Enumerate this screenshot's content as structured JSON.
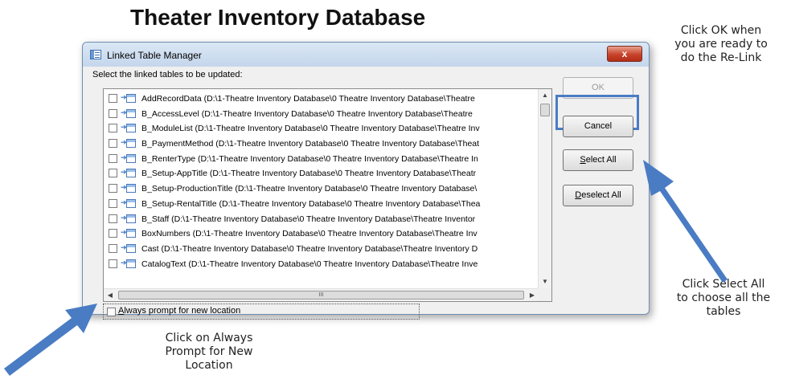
{
  "page": {
    "title": "Theater Inventory Database"
  },
  "annotations": {
    "ok_note": "Click OK when\nyou are ready to\ndo the Re-Link",
    "select_all_note": "Click Select All\nto choose all the\ntables",
    "prompt_note": "Click on Always\nPrompt for New\nLocation",
    "arrow_color": "#4a7cc4"
  },
  "dialog": {
    "title": "Linked Table Manager",
    "close_glyph": "x",
    "instruction": "Select the linked tables to be updated:",
    "tables": [
      {
        "label": "AddRecordData   (D:\\1-Theatre Inventory Database\\0 Theatre Inventory Database\\Theatre"
      },
      {
        "label": "B_AccessLevel   (D:\\1-Theatre Inventory Database\\0 Theatre Inventory Database\\Theatre"
      },
      {
        "label": "B_ModuleList   (D:\\1-Theatre Inventory Database\\0 Theatre Inventory Database\\Theatre Inv"
      },
      {
        "label": "B_PaymentMethod   (D:\\1-Theatre Inventory Database\\0 Theatre Inventory Database\\Theat"
      },
      {
        "label": "B_RenterType   (D:\\1-Theatre Inventory Database\\0 Theatre Inventory Database\\Theatre In"
      },
      {
        "label": "B_Setup-AppTitle   (D:\\1-Theatre Inventory Database\\0 Theatre Inventory Database\\Theatr"
      },
      {
        "label": "B_Setup-ProductionTitle   (D:\\1-Theatre Inventory Database\\0 Theatre Inventory Database\\"
      },
      {
        "label": "B_Setup-RentalTitle   (D:\\1-Theatre Inventory Database\\0 Theatre Inventory Database\\Thea"
      },
      {
        "label": "B_Staff   (D:\\1-Theatre Inventory Database\\0 Theatre Inventory Database\\Theatre Inventor"
      },
      {
        "label": "BoxNumbers   (D:\\1-Theatre Inventory Database\\0 Theatre Inventory Database\\Theatre Inv"
      },
      {
        "label": "Cast   (D:\\1-Theatre Inventory Database\\0 Theatre Inventory Database\\Theatre Inventory D"
      },
      {
        "label": "CatalogText   (D:\\1-Theatre Inventory Database\\0 Theatre Inventory Database\\Theatre Inve"
      }
    ],
    "scroll_thumb_grip": "III",
    "buttons": {
      "ok": "OK",
      "cancel": "Cancel",
      "select_all": "Select All",
      "deselect_all": "Deselect All"
    },
    "always_prompt_label": "Always prompt for new location"
  }
}
